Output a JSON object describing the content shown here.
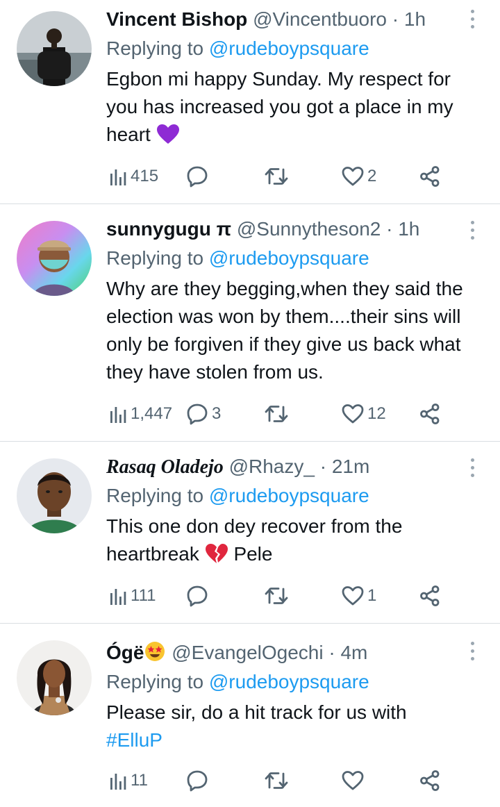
{
  "tweets": [
    {
      "display_name": "Vincent Bishop",
      "handle": "@Vincentbuoro",
      "time": "1h",
      "replying_label": "Replying to",
      "replying_to": "@rudeboypsquare",
      "text": "Egbon mi happy Sunday. My respect for you  has increased you got a place in my heart",
      "emoji": "purple-heart",
      "views": "415",
      "replies": "",
      "retweets": "",
      "likes": "2"
    },
    {
      "display_name": "sunnygugu π",
      "handle": "@Sunnytheson2",
      "time": "1h",
      "replying_label": "Replying to",
      "replying_to": "@rudeboypsquare",
      "text": "Why are they begging,when they said the election was won by them....their sins will only be forgiven if they give us back what they have stolen from us.",
      "views": "1,447",
      "replies": "3",
      "retweets": "",
      "likes": "12"
    },
    {
      "display_name": "Rasaq Oladejo",
      "handle": "@Rhazy_",
      "time": "21m",
      "replying_label": "Replying to",
      "replying_to": "@rudeboypsquare",
      "text_before": "This one don dey recover from the heartbreak",
      "text_after": "Pele",
      "emoji": "broken-heart",
      "views": "111",
      "replies": "",
      "retweets": "",
      "likes": "1"
    },
    {
      "display_name": "Ógë",
      "name_emoji": "star-struck",
      "handle": "@EvangelOgechi",
      "time": "4m",
      "replying_label": "Replying to",
      "replying_to": "@rudeboypsquare",
      "text": "Please sir, do a hit track for us with",
      "hashtag": "#ElluP",
      "views": "11",
      "replies": "",
      "retweets": "",
      "likes": ""
    }
  ],
  "colors": {
    "link": "#1d9bf0",
    "secondary_text": "#536471",
    "primary_text": "#0f1419",
    "divider": "#d9dee2"
  }
}
